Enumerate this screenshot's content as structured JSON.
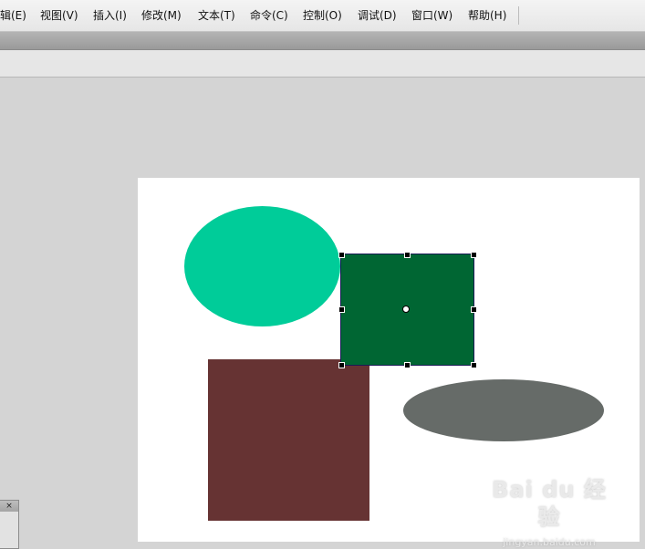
{
  "menu": {
    "items": [
      {
        "label": "编辑(E)",
        "visible": "辑(E)"
      },
      {
        "label": "视图(V)"
      },
      {
        "label": "插入(I)"
      },
      {
        "label": "修改(M)"
      },
      {
        "label": "文本(T)"
      },
      {
        "label": "命令(C)"
      },
      {
        "label": "控制(O)"
      },
      {
        "label": "调试(D)"
      },
      {
        "label": "窗口(W)"
      },
      {
        "label": "帮助(H)"
      }
    ]
  },
  "panel": {
    "close_glyph": "×"
  },
  "stage": {
    "shapes": [
      {
        "name": "teal-ellipse",
        "color": "#00cc99"
      },
      {
        "name": "brown-rectangle",
        "color": "#663333"
      },
      {
        "name": "gray-ellipse",
        "color": "#666b68"
      },
      {
        "name": "green-rectangle",
        "color": "#006633",
        "selected": true
      }
    ]
  },
  "watermark": {
    "brand": "Bai du 经验",
    "url": "jingyan.baidu.com"
  }
}
